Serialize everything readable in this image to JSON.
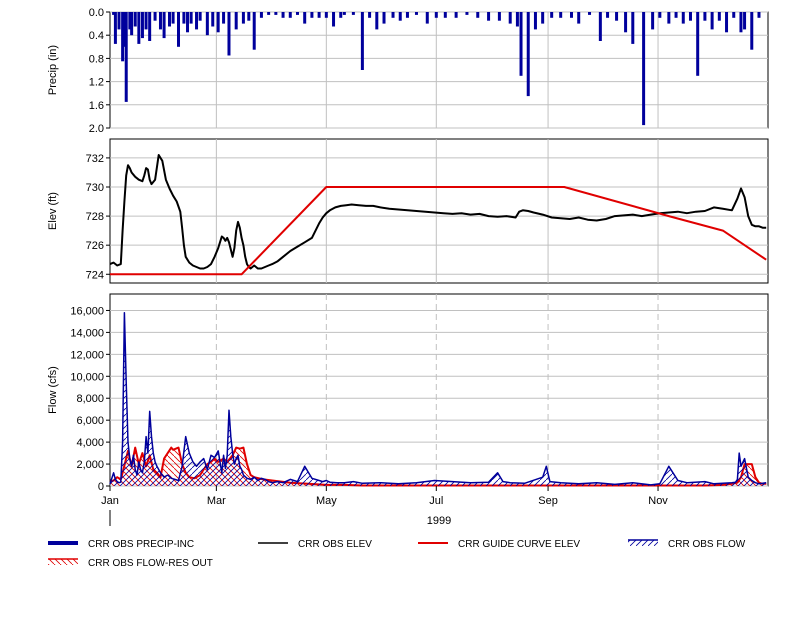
{
  "colors": {
    "precip": "#00009c",
    "elev": "#000000",
    "guide": "#e00000",
    "flow": "#00009c",
    "resout": "#e00000",
    "grid": "#c0c0c0"
  },
  "chart_data": [
    {
      "type": "bar",
      "ylabel": "Precip (in)",
      "ylim": [
        0,
        2
      ],
      "y_inverted": true,
      "yticks": [
        "0.0",
        "0.4",
        "0.8",
        "1.2",
        "1.6",
        "2.0"
      ],
      "grid": true,
      "series": [
        {
          "name": "CRR OBS PRECIP-INC",
          "x_doy": [
            2,
            3,
            5,
            7,
            8,
            9,
            11,
            12,
            14,
            16,
            18,
            20,
            22,
            25,
            28,
            30,
            33,
            35,
            38,
            41,
            43,
            45,
            48,
            50,
            54,
            57,
            60,
            63,
            66,
            70,
            74,
            77,
            80,
            84,
            88,
            92,
            96,
            100,
            104,
            108,
            112,
            116,
            120,
            124,
            128,
            130,
            135,
            140,
            144,
            148,
            152,
            157,
            161,
            165,
            170,
            176,
            181,
            186,
            192,
            198,
            204,
            210,
            216,
            222,
            226,
            228,
            232,
            236,
            240,
            245,
            250,
            256,
            260,
            266,
            272,
            276,
            281,
            286,
            290,
            296,
            301,
            305,
            310,
            314,
            318,
            322,
            326,
            330,
            334,
            338,
            342,
            346,
            350,
            352,
            356,
            360
          ],
          "values": [
            0.05,
            0.55,
            0.3,
            0.85,
            0.6,
            1.55,
            0.3,
            0.4,
            0.25,
            0.55,
            0.45,
            0.3,
            0.5,
            0.15,
            0.3,
            0.45,
            0.25,
            0.2,
            0.6,
            0.2,
            0.35,
            0.2,
            0.3,
            0.15,
            0.4,
            0.25,
            0.35,
            0.2,
            0.75,
            0.3,
            0.2,
            0.15,
            0.65,
            0.1,
            0.05,
            0.05,
            0.1,
            0.1,
            0.05,
            0.2,
            0.1,
            0.1,
            0.1,
            0.25,
            0.1,
            0.05,
            0.05,
            1.0,
            0.1,
            0.3,
            0.2,
            0.1,
            0.15,
            0.1,
            0.05,
            0.2,
            0.1,
            0.1,
            0.1,
            0.05,
            0.1,
            0.15,
            0.15,
            0.2,
            0.25,
            1.1,
            1.45,
            0.3,
            0.2,
            0.1,
            0.1,
            0.1,
            0.2,
            0.05,
            0.5,
            0.1,
            0.15,
            0.35,
            0.55,
            1.95,
            0.3,
            0.1,
            0.2,
            0.1,
            0.2,
            0.15,
            1.1,
            0.15,
            0.3,
            0.15,
            0.35,
            0.1,
            0.35,
            0.3,
            0.65,
            0.1
          ]
        }
      ]
    },
    {
      "type": "line",
      "ylabel": "Elev (ft)",
      "ylim": [
        723.4,
        733.3
      ],
      "yticks": [
        "724",
        "726",
        "728",
        "730",
        "732"
      ],
      "grid": true,
      "series": [
        {
          "name": "CRR OBS ELEV",
          "x_doy": [
            0,
            2,
            4,
            6,
            7,
            8,
            9,
            10,
            11,
            12,
            14,
            16,
            18,
            19,
            20,
            21,
            22,
            23,
            25,
            27,
            29,
            31,
            33,
            35,
            37,
            39,
            40,
            41,
            42,
            44,
            46,
            48,
            50,
            52,
            54,
            56,
            58,
            60,
            62,
            63,
            64,
            65,
            66,
            67,
            68,
            69,
            70,
            71,
            72,
            73,
            74,
            75,
            76,
            77,
            78,
            80,
            82,
            84,
            86,
            88,
            90,
            93,
            96,
            100,
            104,
            108,
            112,
            116,
            118,
            120,
            122,
            125,
            128,
            131,
            134,
            138,
            142,
            146,
            150,
            155,
            160,
            165,
            170,
            175,
            180,
            185,
            190,
            195,
            200,
            205,
            210,
            215,
            220,
            225,
            227,
            229,
            232,
            235,
            240,
            245,
            250,
            255,
            260,
            265,
            270,
            275,
            280,
            285,
            290,
            295,
            300,
            305,
            310,
            315,
            320,
            325,
            330,
            335,
            340,
            345,
            348,
            350,
            352,
            354,
            356,
            358,
            360,
            362,
            364
          ],
          "values": [
            724.7,
            724.8,
            724.6,
            724.7,
            727.0,
            729.0,
            730.8,
            731.5,
            731.3,
            731.0,
            730.7,
            730.5,
            730.4,
            730.8,
            731.3,
            731.2,
            730.5,
            730.2,
            730.5,
            732.2,
            731.8,
            730.5,
            729.9,
            729.4,
            729.0,
            728.3,
            727.2,
            726.0,
            725.2,
            724.8,
            724.6,
            724.5,
            724.4,
            724.4,
            724.5,
            724.7,
            725.2,
            725.8,
            726.6,
            726.5,
            726.3,
            726.5,
            726.2,
            725.7,
            725.2,
            725.8,
            727.0,
            727.6,
            727.2,
            726.5,
            726.0,
            725.2,
            724.7,
            724.5,
            724.4,
            724.6,
            724.4,
            724.4,
            724.5,
            724.6,
            724.7,
            724.9,
            725.2,
            725.6,
            725.9,
            726.2,
            726.5,
            727.5,
            727.9,
            728.2,
            728.4,
            728.6,
            728.7,
            728.75,
            728.8,
            728.75,
            728.7,
            728.7,
            728.6,
            728.5,
            728.45,
            728.4,
            728.35,
            728.3,
            728.25,
            728.2,
            728.15,
            728.2,
            728.1,
            728.15,
            728.0,
            727.95,
            728.0,
            727.9,
            728.3,
            728.4,
            728.35,
            728.25,
            728.1,
            727.9,
            727.85,
            727.8,
            727.9,
            727.75,
            727.7,
            727.8,
            728.0,
            728.05,
            728.1,
            728.0,
            728.1,
            728.2,
            728.25,
            728.3,
            728.2,
            728.3,
            728.35,
            728.6,
            728.5,
            728.4,
            729.2,
            729.9,
            729.3,
            728.0,
            727.4,
            727.3,
            727.3,
            727.2,
            727.2
          ]
        },
        {
          "name": "CRR GUIDE CURVE ELEV",
          "x_doy": [
            0,
            73,
            120,
            252,
            310,
            340,
            364
          ],
          "values": [
            724.0,
            724.0,
            730.0,
            730.0,
            728.0,
            727.0,
            725.0
          ]
        }
      ]
    },
    {
      "type": "area",
      "ylabel": "Flow (cfs)",
      "ylim": [
        0,
        17500
      ],
      "yticks": [
        "0",
        "2,000",
        "4,000",
        "6,000",
        "8,000",
        "10,000",
        "12,000",
        "14,000",
        "16,000"
      ],
      "grid": true,
      "series": [
        {
          "name": "CRR OBS FLOW",
          "x_doy": [
            0,
            2,
            3,
            4,
            5,
            6,
            7,
            8,
            9,
            10,
            11,
            12,
            13,
            14,
            15,
            16,
            17,
            18,
            19,
            20,
            21,
            22,
            23,
            24,
            25,
            26,
            27,
            28,
            29,
            30,
            32,
            34,
            36,
            38,
            40,
            42,
            44,
            46,
            48,
            50,
            52,
            54,
            56,
            58,
            60,
            62,
            63,
            64,
            65,
            66,
            67,
            68,
            69,
            70,
            71,
            72,
            73,
            74,
            76,
            78,
            80,
            82,
            84,
            86,
            88,
            90,
            93,
            96,
            100,
            104,
            108,
            112,
            116,
            118,
            120,
            122,
            126,
            130,
            135,
            140,
            150,
            160,
            170,
            180,
            190,
            200,
            210,
            215,
            218,
            222,
            230,
            240,
            242,
            244,
            250,
            260,
            270,
            280,
            290,
            300,
            305,
            310,
            315,
            320,
            330,
            335,
            340,
            345,
            347,
            348,
            349,
            350,
            352,
            354,
            356,
            358,
            360,
            362,
            364
          ],
          "values": [
            200,
            1200,
            600,
            400,
            300,
            350,
            4000,
            15800,
            9500,
            4000,
            2500,
            1800,
            2800,
            1500,
            1000,
            2200,
            1500,
            1200,
            2200,
            4500,
            3000,
            6800,
            4500,
            3000,
            2200,
            1800,
            1500,
            1200,
            1000,
            800,
            1000,
            700,
            600,
            500,
            1800,
            4500,
            3000,
            2200,
            1800,
            2200,
            2500,
            1500,
            2800,
            2600,
            3200,
            1200,
            2800,
            1600,
            2800,
            6900,
            4500,
            3000,
            2000,
            2500,
            2800,
            1800,
            1500,
            1000,
            700,
            600,
            800,
            500,
            700,
            600,
            400,
            300,
            400,
            300,
            600,
            400,
            1800,
            700,
            500,
            400,
            500,
            350,
            300,
            300,
            400,
            250,
            300,
            200,
            300,
            500,
            400,
            300,
            350,
            1200,
            400,
            300,
            250,
            800,
            1800,
            400,
            300,
            200,
            300,
            150,
            300,
            100,
            200,
            1800,
            500,
            300,
            400,
            200,
            250,
            300,
            350,
            600,
            3000,
            1800,
            2500,
            800,
            500,
            300,
            200,
            250,
            300
          ]
        },
        {
          "name": "CRR OBS FLOW-RES OUT",
          "x_doy": [
            0,
            2,
            4,
            6,
            7,
            10,
            12,
            14,
            16,
            18,
            20,
            22,
            24,
            26,
            28,
            30,
            32,
            34,
            35,
            38,
            40,
            42,
            44,
            47,
            50,
            52,
            54,
            56,
            58,
            60,
            63,
            65,
            68,
            70,
            72,
            74,
            76,
            78,
            80,
            85,
            90,
            95,
            100,
            110,
            120,
            130,
            140,
            160,
            180,
            200,
            220,
            240,
            260,
            280,
            300,
            320,
            330,
            340,
            345,
            348,
            350,
            352,
            354,
            356,
            358,
            360,
            362,
            364
          ],
          "values": [
            400,
            500,
            800,
            600,
            1200,
            3200,
            1800,
            3500,
            2000,
            3000,
            1800,
            2800,
            1500,
            1200,
            800,
            2500,
            3000,
            3500,
            3300,
            3500,
            2000,
            1200,
            800,
            700,
            1000,
            1500,
            2000,
            2200,
            2500,
            2200,
            2500,
            2200,
            2800,
            3500,
            3400,
            3500,
            2000,
            1000,
            800,
            600,
            500,
            400,
            300,
            200,
            100,
            100,
            50,
            50,
            50,
            50,
            50,
            50,
            50,
            50,
            50,
            50,
            50,
            100,
            200,
            300,
            800,
            2000,
            2000,
            2000,
            800,
            300,
            200,
            200
          ]
        }
      ]
    }
  ],
  "x_axis": {
    "month_labels": [
      "Jan",
      "Mar",
      "May",
      "Jul",
      "Sep",
      "Nov"
    ],
    "month_doy": [
      0,
      59,
      120,
      181,
      243,
      304
    ],
    "year_label": "1999"
  },
  "legend": [
    {
      "label": "CRR OBS PRECIP-INC",
      "style": "thick-line",
      "color": "#00009c"
    },
    {
      "label": "CRR OBS ELEV",
      "style": "line",
      "color": "#000000"
    },
    {
      "label": "CRR GUIDE CURVE ELEV",
      "style": "line",
      "color": "#e00000"
    },
    {
      "label": "CRR OBS FLOW",
      "style": "hatch",
      "color": "#00009c"
    },
    {
      "label": "CRR OBS FLOW-RES OUT",
      "style": "hatch",
      "color": "#e00000"
    }
  ]
}
